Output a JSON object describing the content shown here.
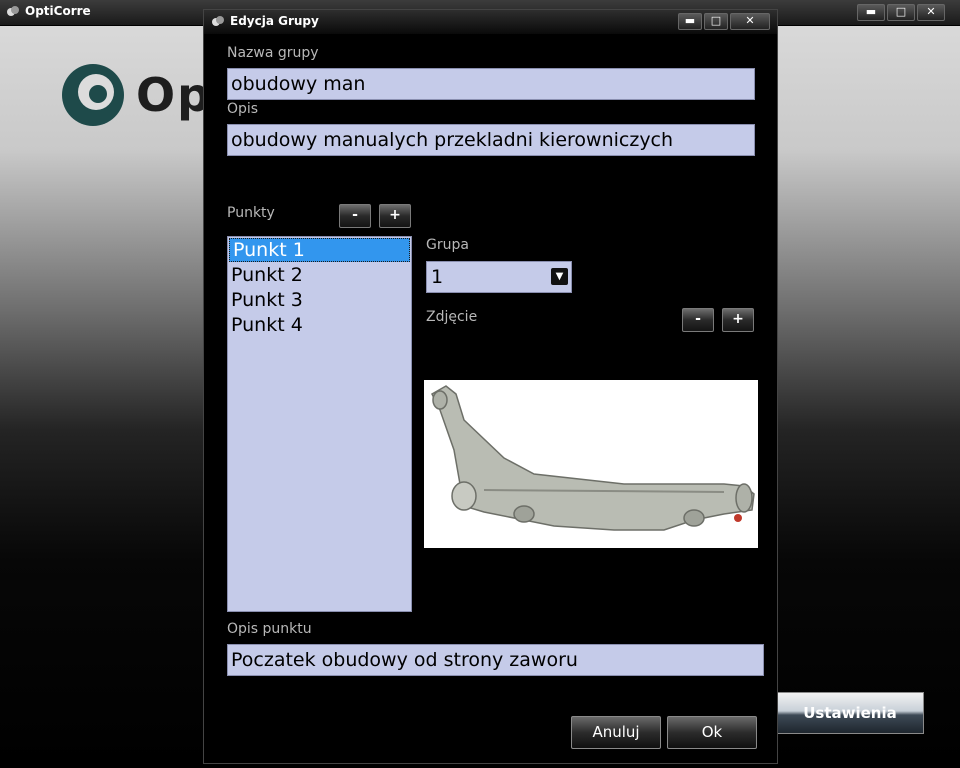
{
  "app": {
    "title": "OptiCorre",
    "logo_text": "Op",
    "controls": {
      "minimize": "▬",
      "maximize": "□",
      "close": "✕"
    }
  },
  "background_button": {
    "label": "Ustawienia"
  },
  "dialog": {
    "title": "Edycja Grupy",
    "controls": {
      "minimize": "▬",
      "maximize": "□",
      "close": "✕"
    },
    "group_name_label": "Nazwa grupy",
    "group_name_value": "obudowy man",
    "description_label": "Opis",
    "description_value": "obudowy manualych przekladni kierowniczych",
    "points_label": "Punkty",
    "points_remove": "-",
    "points_add": "+",
    "points": [
      {
        "label": "Punkt 1",
        "selected": true
      },
      {
        "label": "Punkt 2",
        "selected": false
      },
      {
        "label": "Punkt 3",
        "selected": false
      },
      {
        "label": "Punkt 4",
        "selected": false
      }
    ],
    "group_label": "Grupa",
    "group_selected": "1",
    "photo_label": "Zdjęcie",
    "photo_remove": "-",
    "photo_add": "+",
    "point_description_label": "Opis punktu",
    "point_description_value": "Poczatek obudowy od strony zaworu",
    "cancel_label": "Anuluj",
    "ok_label": "Ok"
  },
  "colors": {
    "field_bg": "#c5cbe9",
    "selection": "#3296ee",
    "label_text": "#b8b8b8"
  }
}
